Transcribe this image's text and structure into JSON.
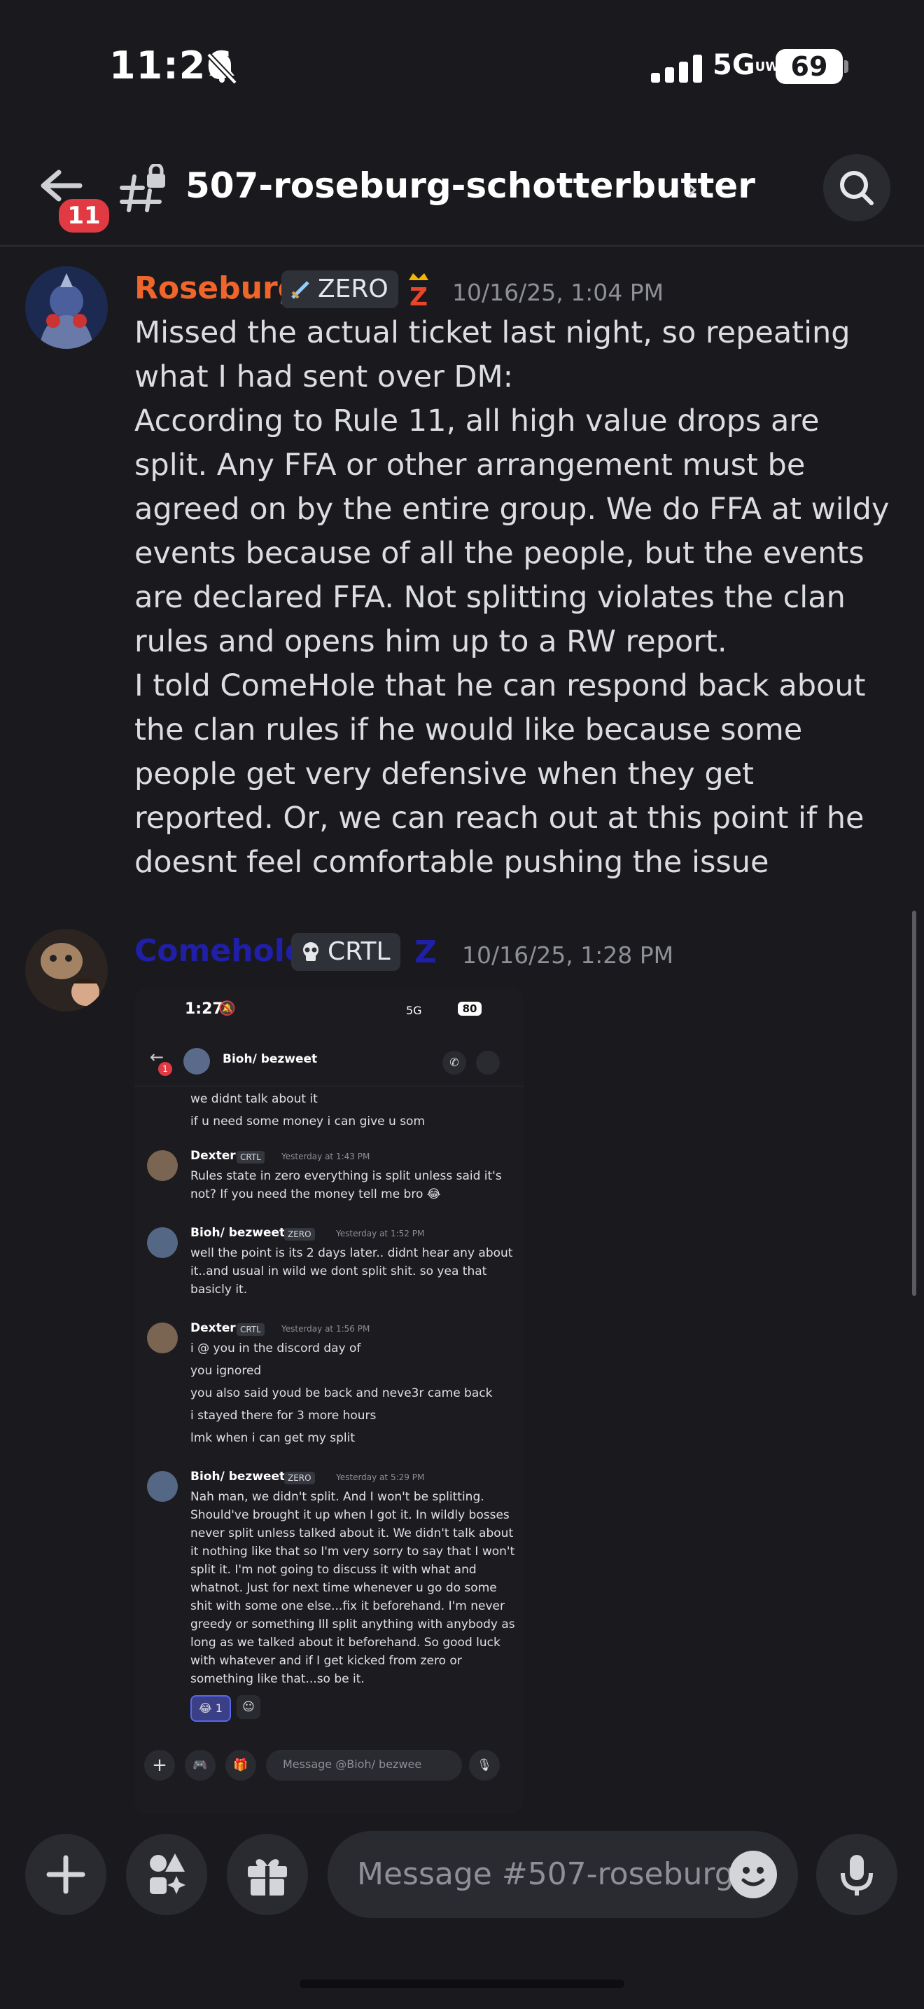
{
  "status_bar": {
    "time": "11:26",
    "network": "5G",
    "network_sub": "UW",
    "battery": "69"
  },
  "header": {
    "unread_count": "11",
    "channel_name": "507-roseburg-schotterbutter"
  },
  "messages": [
    {
      "author": "Roseburg",
      "author_color": "#f0652a",
      "role_label": "ZERO",
      "badge_glyph": "Z",
      "timestamp": "10/16/25, 1:04 PM",
      "lines": [
        "Missed the actual ticket last night, so repeating what I had sent over DM:",
        "According to Rule 11, all high value drops are split. Any FFA or other arrangement must be agreed on by the entire group. We do FFA at wildy events because of all the people, but the events are declared FFA. Not splitting violates the clan rules and opens him up to a RW report.",
        "I told ComeHole that he can respond back about the clan rules if he would like because some people get very defensive when they get reported. Or, we can reach out at this point if he doesnt feel comfortable pushing the issue"
      ]
    },
    {
      "author": "Comehole",
      "author_color": "#1f1fa8",
      "role_label": "CRTL",
      "badge_glyph": "Z",
      "timestamp": "10/16/25, 1:28 PM"
    }
  ],
  "attachment": {
    "status_time": "1:27",
    "network": "5G",
    "battery": "80",
    "dm_name": "Bioh/ bezweet",
    "unread": "1",
    "top_lines": [
      "we didnt talk about it",
      "if u need some money i can give u som"
    ],
    "msgs": [
      {
        "author": "Dexter",
        "tag": "CRTL",
        "time": "Yesterday at 1:43 PM",
        "lines": [
          "Rules state in zero everything is split unless said it's",
          "not? If you need the money tell me bro 😂"
        ]
      },
      {
        "author": "Bioh/ bezweet",
        "tag": "ZERO",
        "time": "Yesterday at 1:52 PM",
        "lines": [
          "well the point is its 2 days later.. didnt hear any about",
          "it..and usual in wild we dont split shit. so yea that",
          "basicly it."
        ]
      },
      {
        "author": "Dexter",
        "tag": "CRTL",
        "time": "Yesterday at 1:56 PM",
        "lines": [
          "i @ you in the discord day of",
          "you ignored",
          "you also said youd be back and neve3r came back",
          "i stayed there for 3 more hours",
          "lmk when i can get my split"
        ]
      },
      {
        "author": "Bioh/ bezweet",
        "tag": "ZERO",
        "time": "Yesterday at 5:29 PM",
        "lines": [
          "Nah man, we didn't split. And I won't be splitting.",
          "Should've brought it up when I got it. In wildly bosses",
          "never split unless talked about it. We didn't talk about",
          "it nothing like that so I'm very sorry to say that I won't",
          "split it. I'm not going to discuss it with what and",
          "whatnot. Just for next time whenever u go do some",
          "shit with some one else...fix it beforehand. I'm never",
          "greedy or something Ill split anything with anybody as",
          "long as we talked about it beforehand.  So good luck",
          "with whatever and if I get kicked from zero or",
          "something like that...so be it."
        ]
      }
    ],
    "reaction_count": "1",
    "reaction_emoji": "😂",
    "input_placeholder": "Message @Bioh/ bezwee"
  },
  "composer": {
    "placeholder": "Message #507-roseburg.."
  },
  "colors": {
    "background": "#1a1a1e",
    "badge_red": "#e23a42"
  },
  "icons": [
    "back-arrow-icon",
    "hashtag-lock-icon",
    "search-icon",
    "plus-icon",
    "apps-icon",
    "gift-icon",
    "emoji-icon",
    "microphone-icon",
    "bell-slash-icon"
  ]
}
